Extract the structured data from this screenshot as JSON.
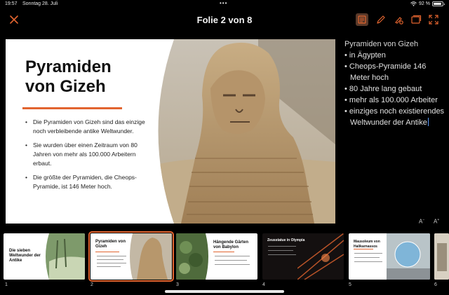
{
  "status": {
    "time": "19:57",
    "date": "Sonntag 28. Juli",
    "battery": "92 %"
  },
  "toolbar": {
    "title": "Folie 2 von 8"
  },
  "slide": {
    "title": "Pyramiden von Gizeh",
    "bullets": [
      "Die Pyramiden von Gizeh sind das einzige noch verbleibende antike Weltwunder.",
      "Sie wurden über einen Zeitraum von 80 Jahren von mehr als 100.000 Arbeitern erbaut.",
      "Die größte der Pyramiden, die Cheops-Pyramide, ist 146 Meter hoch."
    ]
  },
  "notes": {
    "title": "Pyramiden von Gizeh",
    "items": [
      "in Ägypten",
      "Cheops-Pyramide 146 Meter hoch",
      "80 Jahre lang gebaut",
      "mehr als 100.000 Arbeiter",
      "einziges noch existierendes Weltwunder der Antike"
    ],
    "font_decrease": "A",
    "font_increase": "A"
  },
  "thumbnails": [
    {
      "num": "1",
      "title": "Die sieben Weltwunder der Antike"
    },
    {
      "num": "2",
      "title": "Pyramiden von Gizeh",
      "selected": true
    },
    {
      "num": "3",
      "title": "Hängende Gärten von Babylon"
    },
    {
      "num": "4",
      "title": "Zeusstatue in Olympia"
    },
    {
      "num": "5",
      "title": "Mausoleum von Halikarnassos"
    },
    {
      "num": "6",
      "title": ""
    }
  ],
  "colors": {
    "accent": "#e2642f",
    "background": "#000000"
  }
}
